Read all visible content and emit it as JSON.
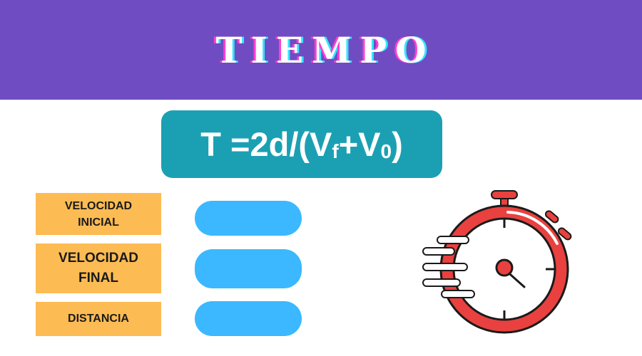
{
  "header": {
    "title": "TIEMPO",
    "bg": "#704cc3"
  },
  "formula": {
    "base": "T =2d/(V",
    "sub_f": "f",
    "plus": "+V",
    "sub_0": "0",
    "close": " )"
  },
  "labels": {
    "initial_velocity": [
      "VELOCIDAD",
      "INICIAL"
    ],
    "final_velocity": [
      "VELOCIDAD",
      "FINAL"
    ],
    "distance": "DISTANCIA"
  },
  "inputs": {
    "initial_velocity": "",
    "final_velocity": "",
    "distance": ""
  },
  "icons": {
    "timer": "stopwatch-icon"
  },
  "colors": {
    "accent": "#1ba0b3",
    "label_bg": "#fdbb53",
    "field_bg": "#3bb8ff",
    "stopwatch": "#e8413f"
  }
}
